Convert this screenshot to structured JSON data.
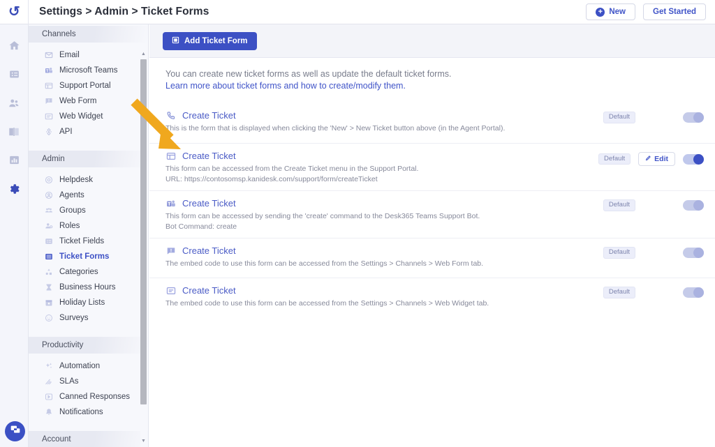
{
  "topbar": {
    "logo_icon": "desk365-logo-icon",
    "breadcrumb": "Settings > Admin > Ticket Forms",
    "new_button": "New",
    "get_started_button": "Get Started"
  },
  "rail": {
    "items": [
      {
        "name": "home",
        "icon": "home-icon",
        "active": false
      },
      {
        "name": "tickets",
        "icon": "ticket-icon",
        "active": false
      },
      {
        "name": "contacts",
        "icon": "people-icon",
        "active": false
      },
      {
        "name": "knowledge-base",
        "icon": "book-icon",
        "active": false
      },
      {
        "name": "reports",
        "icon": "bar-chart-icon",
        "active": false
      },
      {
        "name": "settings",
        "icon": "gear-icon",
        "active": true
      }
    ],
    "chat_icon": "chat-bubble-icon"
  },
  "sidebar": {
    "sections": [
      {
        "title": "Channels",
        "items": [
          {
            "label": "Email",
            "icon": "envelope-icon",
            "active": false
          },
          {
            "label": "Microsoft Teams",
            "icon": "teams-icon",
            "active": false
          },
          {
            "label": "Support Portal",
            "icon": "portal-icon",
            "active": false
          },
          {
            "label": "Web Form",
            "icon": "web-form-icon",
            "active": false
          },
          {
            "label": "Web Widget",
            "icon": "web-widget-icon",
            "active": false
          },
          {
            "label": "API",
            "icon": "api-icon",
            "active": false
          }
        ]
      },
      {
        "title": "Admin",
        "items": [
          {
            "label": "Helpdesk",
            "icon": "lifebuoy-icon",
            "active": false
          },
          {
            "label": "Agents",
            "icon": "agent-icon",
            "active": false
          },
          {
            "label": "Groups",
            "icon": "groups-icon",
            "active": false
          },
          {
            "label": "Roles",
            "icon": "roles-icon",
            "active": false
          },
          {
            "label": "Ticket Fields",
            "icon": "ticket-fields-icon",
            "active": false
          },
          {
            "label": "Ticket Forms",
            "icon": "ticket-forms-icon",
            "active": true
          },
          {
            "label": "Categories",
            "icon": "categories-icon",
            "active": false
          },
          {
            "label": "Business Hours",
            "icon": "hourglass-icon",
            "active": false
          },
          {
            "label": "Holiday Lists",
            "icon": "calendar-icon",
            "active": false
          },
          {
            "label": "Surveys",
            "icon": "smiley-icon",
            "active": false
          }
        ]
      },
      {
        "title": "Productivity",
        "items": [
          {
            "label": "Automation",
            "icon": "sparkle-icon",
            "active": false
          },
          {
            "label": "SLAs",
            "icon": "sla-icon",
            "active": false
          },
          {
            "label": "Canned Responses",
            "icon": "canned-response-icon",
            "active": false
          },
          {
            "label": "Notifications",
            "icon": "bell-icon",
            "active": false
          }
        ]
      },
      {
        "title": "Account",
        "items": []
      }
    ]
  },
  "main": {
    "add_button": "Add Ticket Form",
    "add_button_icon": "form-icon",
    "intro_text": "You can create new ticket forms as well as update the default ticket forms.",
    "intro_link": "Learn more about ticket forms and how to create/modify them.",
    "badge_label": "Default",
    "edit_label": "Edit",
    "edit_icon": "pencil-icon",
    "rows": [
      {
        "icon": "phone-icon",
        "title": "Create Ticket",
        "description": "This is the form that is displayed when clicking the 'New' > New Ticket button above (in the Agent Portal).",
        "sub": "",
        "badge": "Default",
        "has_edit": false,
        "toggle_on": false
      },
      {
        "icon": "portal-icon",
        "title": "Create Ticket",
        "description": "This form can be accessed from the Create Ticket menu in the Support Portal.",
        "sub": "URL: https://contosomsp.kanidesk.com/support/form/createTicket",
        "badge": "Default",
        "has_edit": true,
        "toggle_on": true
      },
      {
        "icon": "teams-icon",
        "title": "Create Ticket",
        "description": "This form can be accessed by sending the 'create' command to the Desk365 Teams Support Bot.",
        "sub": "Bot Command: create",
        "badge": "Default",
        "has_edit": false,
        "toggle_on": false
      },
      {
        "icon": "web-form-icon",
        "title": "Create Ticket",
        "description": "The embed code to use this form can be accessed from the Settings > Channels > Web Form tab.",
        "sub": "",
        "badge": "Default",
        "has_edit": false,
        "toggle_on": false
      },
      {
        "icon": "web-widget-icon",
        "title": "Create Ticket",
        "description": "The embed code to use this form can be accessed from the Settings > Channels > Web Widget tab.",
        "sub": "",
        "badge": "Default",
        "has_edit": false,
        "toggle_on": false
      }
    ]
  },
  "annotation": {
    "type": "arrow",
    "color": "#f0a81e",
    "points_to": "row-2-create-ticket-support-portal"
  },
  "colors": {
    "accent": "#3c50c4",
    "link": "#4054c8",
    "sidebar_bg": "#f7f8fc",
    "toolbar_bg": "#f3f4f9",
    "annotation": "#f0a81e"
  }
}
